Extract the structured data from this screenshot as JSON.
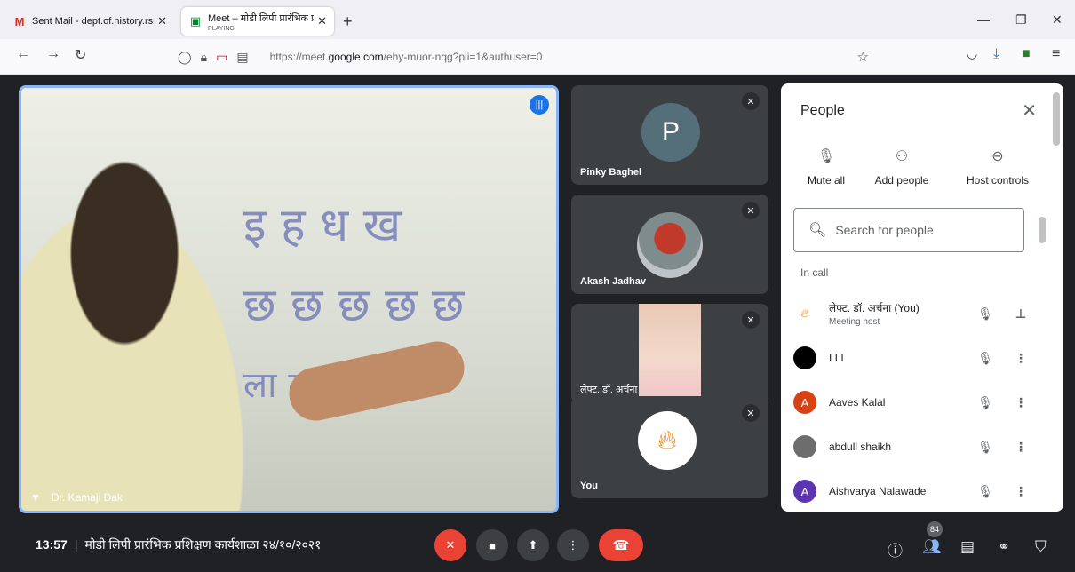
{
  "browser": {
    "tabs": [
      {
        "title": "Sent Mail - dept.of.history.rsml",
        "icon": "gmail-icon"
      },
      {
        "title": "Meet – मोडी लिपी प्रारंभिक प्रशिक्षण",
        "subtitle": "PLAYING",
        "icon": "meet-icon"
      }
    ],
    "url_host_prefix": "https://meet.",
    "url_host": "google.com",
    "url_path": "/ehy-muor-nqg?pli=1&authuser=0"
  },
  "speaker": {
    "name": "Dr. Kamaji Dak",
    "board_lines": [
      "इ ह ध ख",
      "छ छ छ छ छ",
      "ला ला धा"
    ]
  },
  "tiles": [
    {
      "name": "Pinky Baghel",
      "avatar_letter": "P"
    },
    {
      "name": "Akash Jadhav"
    },
    {
      "name": "लेफ्ट. डॉ. अर्चना"
    },
    {
      "name": "You"
    }
  ],
  "people_panel": {
    "title": "People",
    "controls": [
      "Mute all",
      "Add people",
      "Host controls"
    ],
    "search_placeholder": "Search for people",
    "section": "In call",
    "participants": [
      {
        "name": "लेफ्ट. डॉ. अर्चना (You)",
        "role": "Meeting host",
        "avatar_color": "#ffffff"
      },
      {
        "name": "I I I",
        "avatar_color": "#000000"
      },
      {
        "name": "Aaves Kalal",
        "avatar_letter": "A",
        "avatar_color": "#d84315"
      },
      {
        "name": "abdull shaikh",
        "avatar_color": "#6d6d6d"
      },
      {
        "name": "Aishvarya Nalawade",
        "avatar_letter": "A",
        "avatar_color": "#5e35b1"
      }
    ]
  },
  "bottom_bar": {
    "time": "13:57",
    "meeting_title": "मोडी लिपी प्रारंभिक प्रशिक्षण कार्यशाळा २४/१०/२०२१",
    "people_count": "84"
  }
}
